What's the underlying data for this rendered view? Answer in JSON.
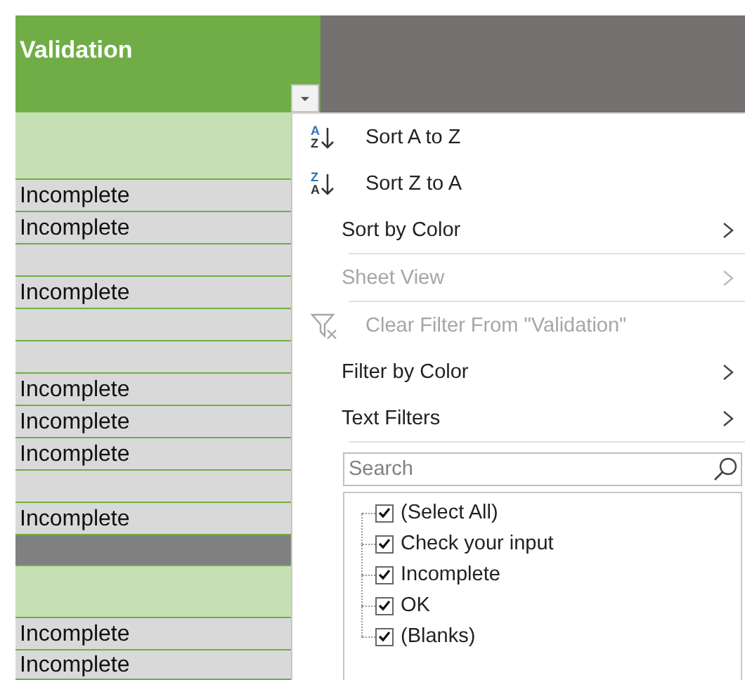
{
  "header": {
    "title": "Validation"
  },
  "rows": [
    {
      "kind": "band"
    },
    {
      "kind": "data",
      "value": "Incomplete"
    },
    {
      "kind": "data",
      "value": "Incomplete"
    },
    {
      "kind": "data"
    },
    {
      "kind": "data",
      "value": "Incomplete"
    },
    {
      "kind": "data"
    },
    {
      "kind": "data"
    },
    {
      "kind": "data",
      "value": "Incomplete"
    },
    {
      "kind": "data",
      "value": "Incomplete"
    },
    {
      "kind": "data",
      "value": "Incomplete"
    },
    {
      "kind": "data"
    },
    {
      "kind": "data",
      "value": "Incomplete"
    },
    {
      "kind": "divider"
    },
    {
      "kind": "band"
    },
    {
      "kind": "data",
      "value": "Incomplete"
    },
    {
      "kind": "data",
      "value": "Incomplete"
    }
  ],
  "menu": {
    "items": [
      {
        "kind": "sort",
        "label": "Sort A to Z",
        "icon_top": "A",
        "icon_bottom": "Z",
        "disabled": false
      },
      {
        "kind": "sort",
        "label": "Sort Z to A",
        "icon_top": "Z",
        "icon_bottom": "A",
        "disabled": false
      },
      {
        "kind": "submenu",
        "label": "Sort by Color",
        "disabled": false
      },
      {
        "kind": "separator"
      },
      {
        "kind": "submenu",
        "label": "Sheet View",
        "disabled": true
      },
      {
        "kind": "separator"
      },
      {
        "kind": "clear",
        "label": "Clear Filter From \"Validation\"",
        "disabled": true
      },
      {
        "kind": "submenu",
        "label": "Filter by Color",
        "disabled": false
      },
      {
        "kind": "submenu",
        "label": "Text Filters",
        "disabled": false
      },
      {
        "kind": "separator"
      }
    ],
    "search": {
      "placeholder": "Search"
    },
    "values": [
      {
        "label": "(Select All)",
        "checked": true
      },
      {
        "label": "Check your input",
        "checked": true
      },
      {
        "label": "Incomplete",
        "checked": true
      },
      {
        "label": "OK",
        "checked": true
      },
      {
        "label": "(Blanks)",
        "checked": true
      }
    ]
  }
}
